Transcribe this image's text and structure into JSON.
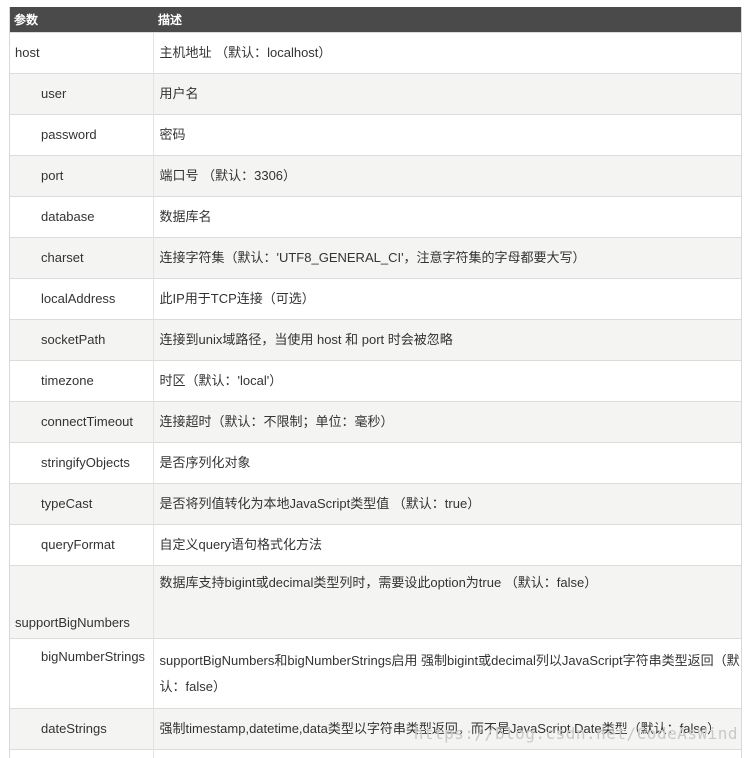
{
  "header": {
    "param": "参数",
    "desc": "描述"
  },
  "rows": [
    {
      "name": "host",
      "desc": "主机地址 （默认：localhost）"
    },
    {
      "name": "user",
      "desc": "用户名"
    },
    {
      "name": "password",
      "desc": "密码"
    },
    {
      "name": "port",
      "desc": "端口号 （默认：3306）"
    },
    {
      "name": "database",
      "desc": "数据库名"
    },
    {
      "name": "charset",
      "desc": "连接字符集（默认：'UTF8_GENERAL_CI'，注意字符集的字母都要大写）"
    },
    {
      "name": "localAddress",
      "desc": "此IP用于TCP连接（可选）"
    },
    {
      "name": "socketPath",
      "desc": "连接到unix域路径，当使用 host 和 port 时会被忽略"
    },
    {
      "name": "timezone",
      "desc": "时区（默认：'local'）"
    },
    {
      "name": "connectTimeout",
      "desc": "连接超时（默认：不限制；单位：毫秒）"
    },
    {
      "name": "stringifyObjects",
      "desc": "是否序列化对象"
    },
    {
      "name": "typeCast",
      "desc": "是否将列值转化为本地JavaScript类型值 （默认：true）"
    },
    {
      "name": "queryFormat",
      "desc": "自定义query语句格式化方法"
    },
    {
      "name": "supportBigNumbers",
      "desc": "数据库支持bigint或decimal类型列时，需要设此option为true （默认：false）"
    },
    {
      "name": "bigNumberStrings",
      "desc": "supportBigNumbers和bigNumberStrings启用 强制bigint或decimal列以JavaScript字符串类型返回（默认：false）"
    },
    {
      "name": "dateStrings",
      "desc": "强制timestamp,datetime,data类型以字符串类型返回，而不是JavaScript Date类型（默认：false）"
    }
  ],
  "watermark": "https://blog.csdn.net/CodeAsWind"
}
